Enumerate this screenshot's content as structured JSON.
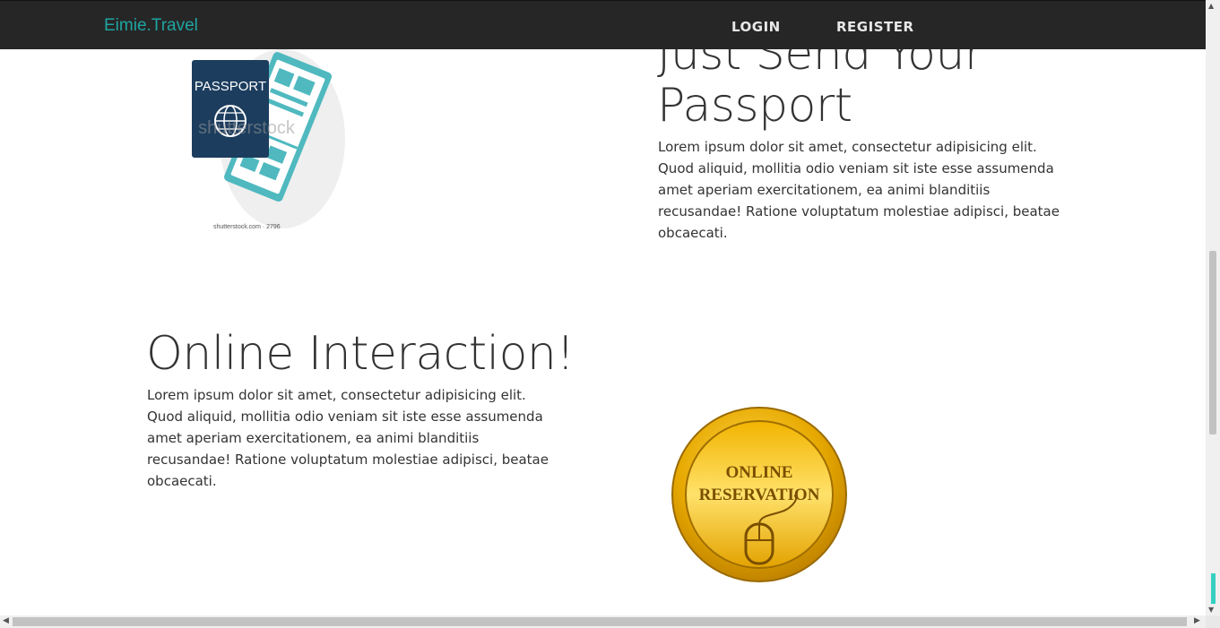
{
  "nav": {
    "brand": "Eimie.Travel",
    "login": "LOGIN",
    "register": "REGISTER"
  },
  "section_passport": {
    "heading_line1": "Just Send Your",
    "heading_line2": "Passport",
    "body": "Lorem ipsum dolor sit amet, consectetur adipisicing elit. Quod aliquid, mollitia odio veniam sit iste esse assumenda amet aperiam exercitationem, ea animi blanditiis recusandae! Ratione voluptatum molestiae adipisci, beatae obcaecati.",
    "image": {
      "passport_text": "PASSPORT",
      "watermark": "shutterstock",
      "caption": "shutterstock.com · 2796"
    }
  },
  "section_online": {
    "heading": "Online Interaction!",
    "body": "Lorem ipsum dolor sit amet, consectetur adipisicing elit. Quod aliquid, mollitia odio veniam sit iste esse assumenda amet aperiam exercitationem, ea animi blanditiis recusandae! Ratione voluptatum molestiae adipisci, beatae obcaecati.",
    "image": {
      "line1": "ONLINE",
      "line2": "RESERVATION"
    }
  },
  "colors": {
    "navbar": "#262627",
    "brand": "#1fa5a0",
    "passport_cover": "#1c3d5e",
    "ticket": "#4fb9bf",
    "gold": "#e6a800"
  }
}
